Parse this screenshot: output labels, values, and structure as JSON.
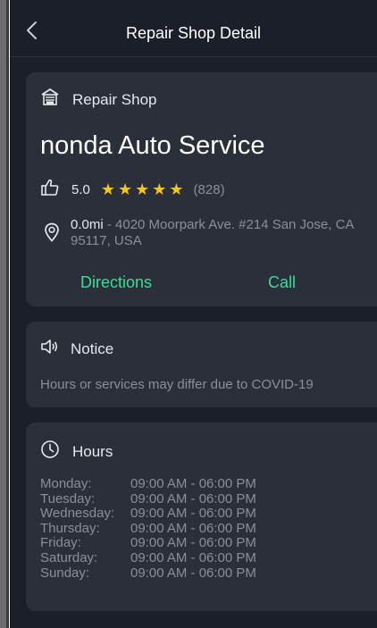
{
  "nav": {
    "title": "Repair Shop Detail",
    "back_icon": "chevron-left-icon"
  },
  "shop": {
    "type_icon": "garage-icon",
    "type_label": "Repair Shop",
    "name": "nonda Auto Service",
    "rating_icon": "thumbs-up-icon",
    "rating": "5.0",
    "stars": 5,
    "review_count": "(828)",
    "location_icon": "location-pin-icon",
    "distance": "0.0mi",
    "address": " - 4020 Moorpark Ave. #214 San Jose, CA 95117, USA",
    "directions_label": "Directions",
    "call_label": "Call"
  },
  "notice": {
    "icon": "speaker-icon",
    "title": "Notice",
    "text": "Hours or services may differ due to COVID-19"
  },
  "hours": {
    "icon": "clock-icon",
    "title": "Hours",
    "rows": [
      {
        "day": "Monday:",
        "time": "09:00 AM - 06:00 PM"
      },
      {
        "day": "Tuesday:",
        "time": "09:00 AM - 06:00 PM"
      },
      {
        "day": "Wednesday:",
        "time": "09:00 AM - 06:00 PM"
      },
      {
        "day": "Thursday:",
        "time": "09:00 AM - 06:00 PM"
      },
      {
        "day": "Friday:",
        "time": "09:00 AM - 06:00 PM"
      },
      {
        "day": "Saturday:",
        "time": "09:00 AM - 06:00 PM"
      },
      {
        "day": "Sunday:",
        "time": "09:00 AM - 06:00 PM"
      }
    ]
  },
  "colors": {
    "background": "#1b1f29",
    "card": "#2a2f3a",
    "accent": "#3ddc97",
    "star": "#f5c518",
    "muted_text": "#8a8f9a"
  }
}
